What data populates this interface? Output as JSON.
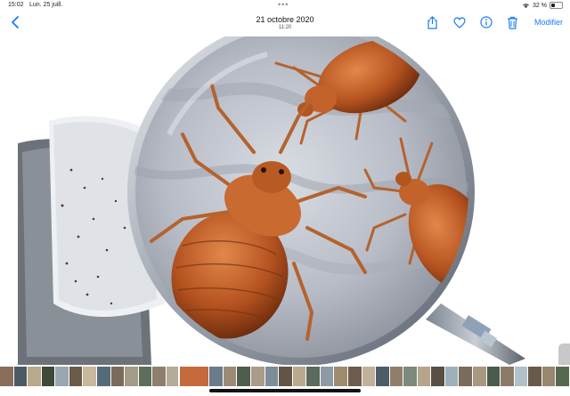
{
  "status_bar": {
    "time": "15:02",
    "date": "Lun. 25 juill.",
    "battery_percent": 32,
    "battery_text": "32 %"
  },
  "nav": {
    "title": "21 octobre 2020",
    "subtitle": "11:20",
    "edit_label": "Modifier",
    "accent_color": "#1a7cf5",
    "icons": [
      "back-chevron-icon",
      "share-icon",
      "heart-icon",
      "info-icon",
      "trash-icon"
    ]
  },
  "thumbnail_strip": {
    "selected_index": 13,
    "colors": [
      "#8a6d5a",
      "#4d5a66",
      "#b8a88c",
      "#3f4a3a",
      "#9aa7b2",
      "#6b5b4a",
      "#c9b89b",
      "#556b7a",
      "#7a6a5b",
      "#a39a88",
      "#5d6e5a",
      "#8e7e6c",
      "#b5ab9a",
      "#c46a3c",
      "#6a7b8c",
      "#9b8a76",
      "#4f5d4c",
      "#aa9c8a",
      "#7e8c98",
      "#625446",
      "#b9a98f",
      "#5b6a5a",
      "#8d9aa5",
      "#a08a70",
      "#6e5d4d",
      "#c0b29a",
      "#4e5c68",
      "#917f6c",
      "#7b8a7a",
      "#b6a48c",
      "#5a4f44",
      "#9fb0bb",
      "#7a6b5c",
      "#a8987f",
      "#4b5a4b",
      "#8c7a68",
      "#b2c0c8",
      "#6a5a4b",
      "#98876f",
      "#57684f"
    ]
  }
}
